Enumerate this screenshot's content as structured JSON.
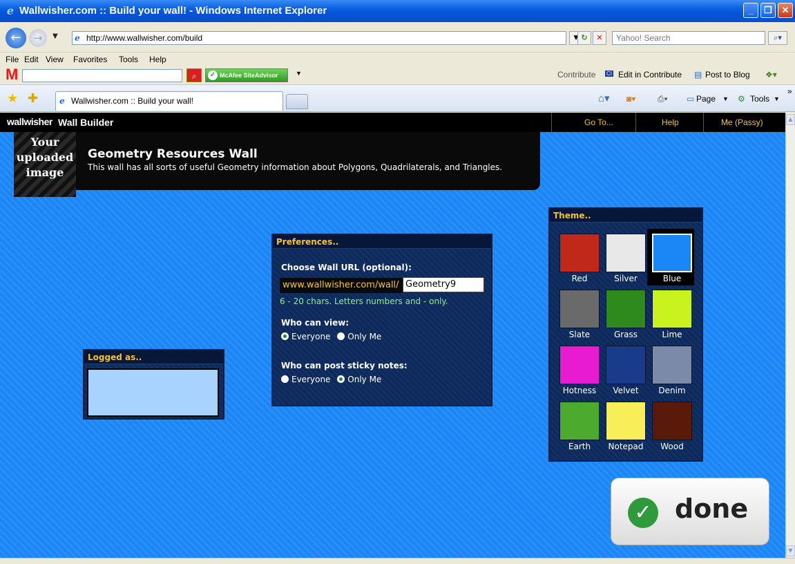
{
  "window": {
    "title": "Wallwisher.com :: Build your wall! - Windows Internet Explorer",
    "minimize": "_",
    "maximize": "❐",
    "close": "✕"
  },
  "address": {
    "url": "http://www.wallwisher.com/build",
    "search_placeholder": "Yahoo! Search"
  },
  "menu": [
    "File",
    "Edit",
    "View",
    "Favorites",
    "Tools",
    "Help"
  ],
  "toolbar": {
    "mcafee_logo": "M",
    "siteadvisor_label": "McAfee SiteAdvisor",
    "contribute_label": "Contribute",
    "edit_in_contribute": "Edit in Contribute",
    "post_to_blog": "Post to Blog"
  },
  "tabs": {
    "active_tab": "Wallwisher.com :: Build your wall!",
    "page_label": "Page",
    "tools_label": "Tools"
  },
  "header": {
    "logo": "wallwisher",
    "title": "Wall Builder",
    "nav": [
      "Go To...",
      "Help",
      "Me (Passy)"
    ]
  },
  "wall": {
    "image_placeholder": [
      "Your",
      "uploaded",
      "image"
    ],
    "title": "Geometry Resources Wall",
    "description": "This wall has all sorts of useful Geometry information about Polygons, Quadrilaterals, and Triangles."
  },
  "logged_as": {
    "heading": "Logged as.."
  },
  "preferences": {
    "heading": "Preferences..",
    "url_label": "Choose Wall URL (optional):",
    "url_prefix": "www.wallwisher.com/wall/",
    "url_value": "Geometry9",
    "url_hint": "6 - 20 chars. Letters numbers and - only.",
    "view_label": "Who can view:",
    "view_options": [
      "Everyone",
      "Only Me"
    ],
    "view_selected": "Everyone",
    "post_label": "Who can post sticky notes:",
    "post_options": [
      "Everyone",
      "Only Me"
    ],
    "post_selected": "Only Me"
  },
  "theme": {
    "heading": "Theme..",
    "selected": "Blue",
    "options": [
      {
        "label": "Red",
        "color": "#c0281a"
      },
      {
        "label": "Silver",
        "color": "#e8e8e8"
      },
      {
        "label": "Blue",
        "color": "#1b86f5"
      },
      {
        "label": "Slate",
        "color": "#6a6a6a"
      },
      {
        "label": "Grass",
        "color": "#2e8a1c"
      },
      {
        "label": "Lime",
        "color": "#c8f31e"
      },
      {
        "label": "Hotness",
        "color": "#e81ad2"
      },
      {
        "label": "Velvet",
        "color": "#1a3a8a"
      },
      {
        "label": "Denim",
        "color": "#7a8aa8"
      },
      {
        "label": "Earth",
        "color": "#4caa2e"
      },
      {
        "label": "Notepad",
        "color": "#f7ee5a"
      },
      {
        "label": "Wood",
        "color": "#5a1a0a"
      }
    ]
  },
  "done": {
    "label": "done"
  }
}
